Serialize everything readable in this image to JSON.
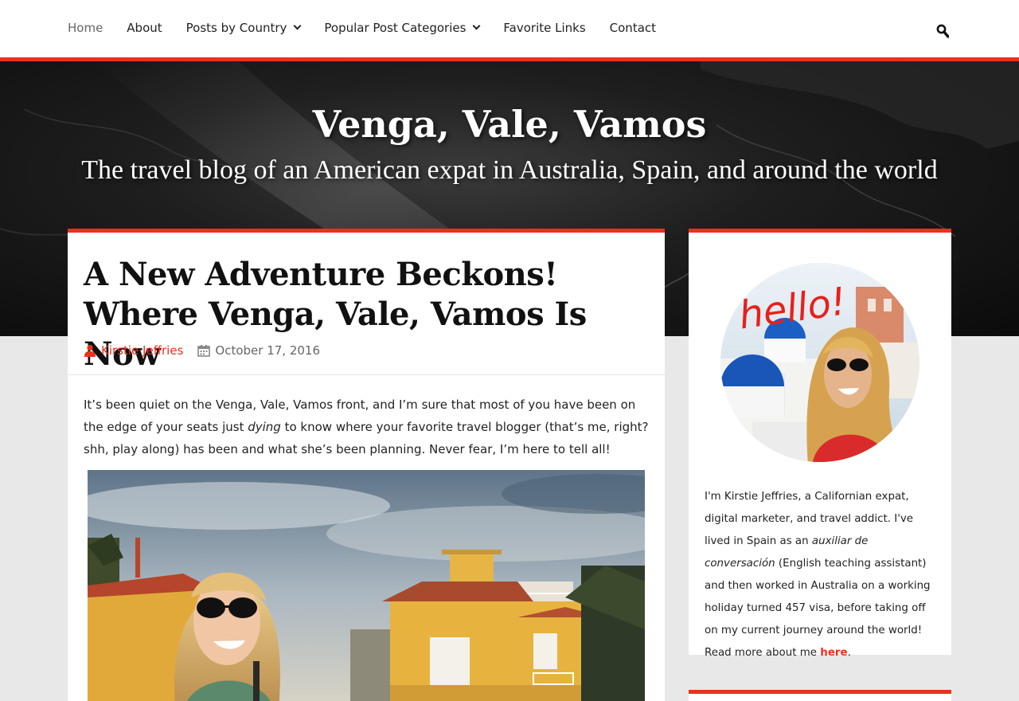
{
  "nav": {
    "items": [
      {
        "label": "Home",
        "dropdown": false,
        "active": true
      },
      {
        "label": "About",
        "dropdown": false,
        "active": false
      },
      {
        "label": "Posts by Country",
        "dropdown": true,
        "active": false
      },
      {
        "label": "Popular Post Categories",
        "dropdown": true,
        "active": false
      },
      {
        "label": "Favorite Links",
        "dropdown": false,
        "active": false
      },
      {
        "label": "Contact",
        "dropdown": false,
        "active": false
      }
    ],
    "search_icon": "search-icon"
  },
  "hero": {
    "title": "Venga, Vale, Vamos",
    "tagline": "The travel blog of an American expat in Australia, Spain, and around the world"
  },
  "post": {
    "title": "A New Adventure Beckons! Where Venga, Vale, Vamos Is Now",
    "author": "Kirstie Jeffries",
    "date": "October 17, 2016",
    "intro_1": "It’s been quiet on the Venga, Vale, Vamos front, and I’m sure that most of you have been on the edge of your seats just ",
    "intro_em": "dying",
    "intro_2": " to know where your favorite travel blogger (that’s me, right? shh, play along) has been and what she’s been planning. Never fear, I’m here to tell all!"
  },
  "sidebar": {
    "hello_text": "hello!",
    "bio_1": "I'm Kirstie Jeffries, a Californian expat, digital marketer, and travel addict. I've lived in Spain as an ",
    "bio_em": "auxiliar de conversación",
    "bio_2": " (English teaching assistant) and then worked in Australia on a working holiday turned 457 visa, before taking off on my current journey around the world! Read more about me ",
    "bio_link": "here",
    "bio_end": "."
  },
  "colors": {
    "accent": "#e8331c",
    "text": "#222222",
    "muted": "#666666"
  }
}
